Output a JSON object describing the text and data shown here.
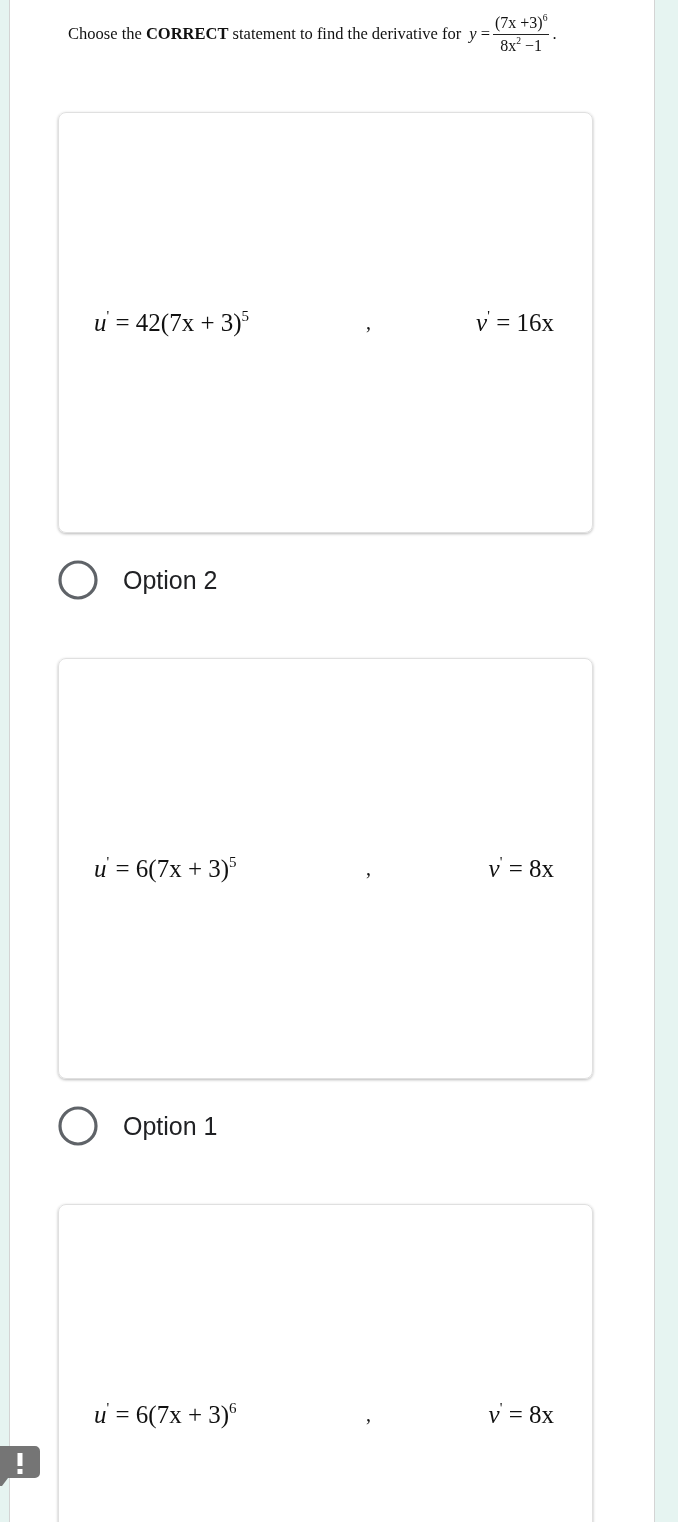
{
  "question": {
    "text": "Choose the **CORRECT** statement to find the derivative for",
    "formula": {
      "lhs": "*y* =",
      "numerator": "(7x +3)$^{6}$",
      "denominator": "8x$^{2}$ −1"
    },
    "end": "."
  },
  "options": [
    {
      "card": {
        "u_derivative": "*u*$^{'}$ = 42(7x + 3)$^{5}$",
        "separator": ",",
        "v_derivative": "*v*$^{'}$ = 16x"
      },
      "label": "Option 2",
      "selected": false
    },
    {
      "card": {
        "u_derivative": "*u*$^{'}$ = 6(7x + 3)$^{5}$",
        "separator": ",",
        "v_derivative": "*v*$^{'}$ = 8x"
      },
      "label": "Option 1",
      "selected": false
    },
    {
      "card": {
        "u_derivative": "*u*$^{'}$ = 6(7x + 3)$^{6}$",
        "separator": ",",
        "v_derivative": "*v*$^{'}$ = 8x"
      }
    }
  ]
}
